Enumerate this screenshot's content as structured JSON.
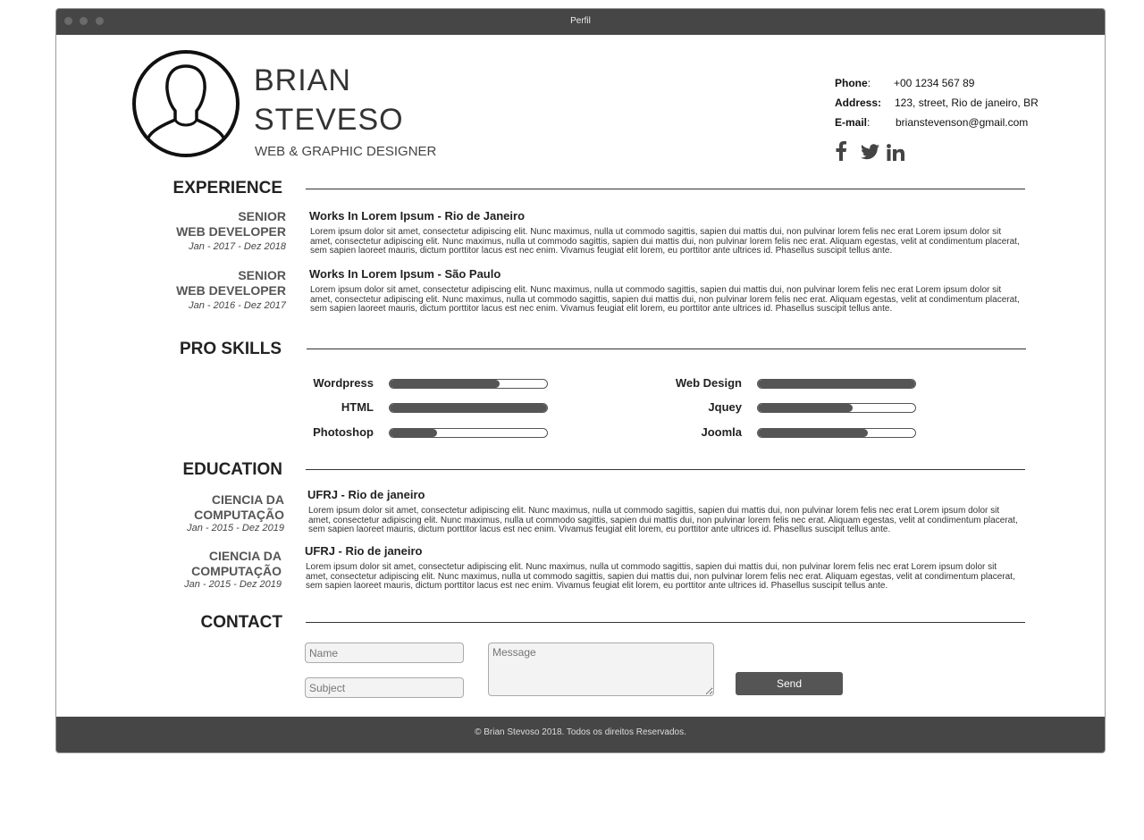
{
  "window": {
    "title": "Perfil"
  },
  "profile": {
    "first_name": "BRIAN",
    "last_name": "STEVESO",
    "role": "WEB & GRAPHIC DESIGNER"
  },
  "contact_info": {
    "phone_label": "Phone",
    "phone": "+00 1234 567 89",
    "address_label": "Address:",
    "address": "123, street, Rio de janeiro, BR",
    "email_label": "E-mail",
    "email": "brianstevenson@gmail.com",
    "social_icons": [
      "facebook-icon",
      "twitter-icon",
      "linkedin-icon"
    ]
  },
  "experience": {
    "title": "EXPERIENCE",
    "items": [
      {
        "position_line1": "SENIOR",
        "position_line2": "WEB DEVELOPER",
        "date": "Jan - 2017 - Dez 2018",
        "heading": "Works In Lorem Ipsum - Rio de Janeiro",
        "text": "Lorem ipsum dolor sit amet, consectetur adipiscing elit. Nunc maximus, nulla ut commodo sagittis, sapien dui mattis dui, non pulvinar lorem felis nec erat Lorem ipsum dolor sit amet, consectetur adipiscing elit. Nunc maximus, nulla ut commodo sagittis, sapien dui mattis dui, non pulvinar lorem felis nec erat. Aliquam egestas, velit at condimentum placerat, sem sapien laoreet mauris, dictum porttitor lacus est nec enim. Vivamus feugiat elit lorem, eu porttitor ante ultrices id. Phasellus suscipit tellus ante."
      },
      {
        "position_line1": "SENIOR",
        "position_line2": "WEB DEVELOPER",
        "date": "Jan - 2016 - Dez 2017",
        "heading": "Works In Lorem Ipsum - São Paulo",
        "text": "Lorem ipsum dolor sit amet, consectetur adipiscing elit. Nunc maximus, nulla ut commodo sagittis, sapien dui mattis dui, non pulvinar lorem felis nec erat Lorem ipsum dolor sit amet, consectetur adipiscing elit. Nunc maximus, nulla ut commodo sagittis, sapien dui mattis dui, non pulvinar lorem felis nec erat. Aliquam egestas, velit at condimentum placerat, sem sapien laoreet mauris, dictum porttitor lacus est nec enim. Vivamus feugiat elit lorem, eu porttitor ante ultrices id. Phasellus suscipit tellus ante."
      }
    ]
  },
  "skills": {
    "title": "PRO SKILLS",
    "items": [
      {
        "label": "Wordpress",
        "level": 0.7
      },
      {
        "label": "HTML",
        "level": 1.0
      },
      {
        "label": "Photoshop",
        "level": 0.3
      },
      {
        "label": "Web Design",
        "level": 1.0
      },
      {
        "label": "Jquey",
        "level": 0.6
      },
      {
        "label": "Joomla",
        "level": 0.7
      }
    ]
  },
  "education": {
    "title": "EDUCATION",
    "items": [
      {
        "course_line1": "CIENCIA DA",
        "course_line2": "COMPUTAÇÃO",
        "date": "Jan - 2015 - Dez 2019",
        "heading": "UFRJ - Rio de janeiro",
        "text": "Lorem ipsum dolor sit amet, consectetur adipiscing elit. Nunc maximus, nulla ut commodo sagittis, sapien dui mattis dui, non pulvinar lorem felis nec erat Lorem ipsum dolor sit amet, consectetur adipiscing elit. Nunc maximus, nulla ut commodo sagittis, sapien dui mattis dui, non pulvinar lorem felis nec erat. Aliquam egestas, velit at condimentum placerat, sem sapien laoreet mauris, dictum porttitor lacus est nec enim. Vivamus feugiat elit lorem, eu porttitor ante ultrices id. Phasellus suscipit tellus ante."
      },
      {
        "course_line1": "CIENCIA DA",
        "course_line2": "COMPUTAÇÃO",
        "date": "Jan - 2015 - Dez 2019",
        "heading": "UFRJ - Rio de janeiro",
        "text": "Lorem ipsum dolor sit amet, consectetur adipiscing elit. Nunc maximus, nulla ut commodo sagittis, sapien dui mattis dui, non pulvinar lorem felis nec erat Lorem ipsum dolor sit amet, consectetur adipiscing elit. Nunc maximus, nulla ut commodo sagittis, sapien dui mattis dui, non pulvinar lorem felis nec erat. Aliquam egestas, velit at condimentum placerat, sem sapien laoreet mauris, dictum porttitor lacus est nec enim. Vivamus feugiat elit lorem, eu porttitor ante ultrices id. Phasellus suscipit tellus ante."
      }
    ]
  },
  "contact": {
    "title": "CONTACT",
    "name_placeholder": "Name",
    "subject_placeholder": "Subject",
    "message_placeholder": "Message",
    "send_label": "Send"
  },
  "footer": {
    "text": "© Brian Stevoso 2018. Todos os direitos Reservados."
  },
  "colors": {
    "titlebar": "#464646",
    "accent": "#555555"
  }
}
